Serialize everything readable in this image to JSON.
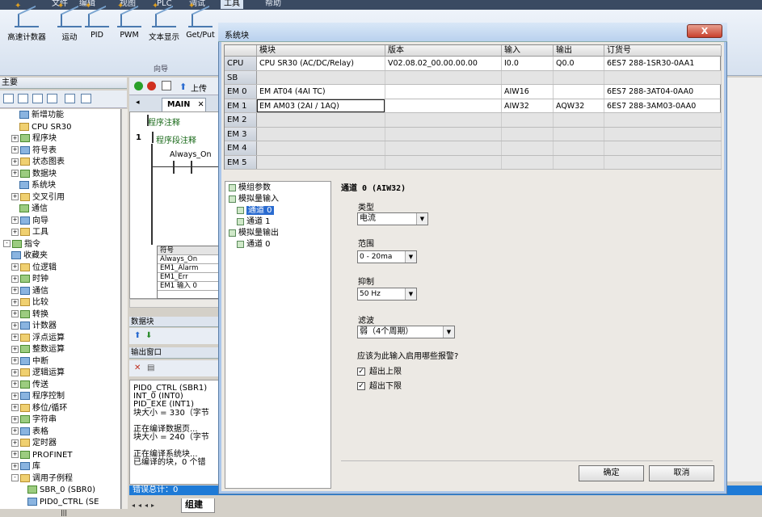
{
  "menubar": {
    "items": [
      "文件",
      "编辑",
      "视图",
      "PLC",
      "调试",
      "工具",
      "帮助"
    ],
    "active": "工具"
  },
  "ribbon": {
    "buttons": [
      "高速计数器",
      "运动",
      "PID",
      "PWM",
      "文本显示",
      "Get/Put"
    ],
    "group": "向导"
  },
  "project_tree": {
    "title": "主要",
    "items": [
      {
        "label": "新增功能",
        "indent": 2,
        "icon": "help-icon"
      },
      {
        "label": "CPU SR30",
        "indent": 2,
        "icon": "cpu-icon"
      },
      {
        "label": "程序块",
        "indent": 1,
        "expand": "+"
      },
      {
        "label": "符号表",
        "indent": 1,
        "expand": "+"
      },
      {
        "label": "状态图表",
        "indent": 1,
        "expand": "+"
      },
      {
        "label": "数据块",
        "indent": 1,
        "expand": "+"
      },
      {
        "label": "系统块",
        "indent": 2
      },
      {
        "label": "交叉引用",
        "indent": 1,
        "expand": "+"
      },
      {
        "label": "通信",
        "indent": 2
      },
      {
        "label": "向导",
        "indent": 1,
        "expand": "+"
      },
      {
        "label": "工具",
        "indent": 1,
        "expand": "+"
      },
      {
        "label": "指令",
        "indent": 0,
        "expand": "-"
      },
      {
        "label": "收藏夹",
        "indent": 1
      },
      {
        "label": "位逻辑",
        "indent": 1,
        "expand": "+"
      },
      {
        "label": "时钟",
        "indent": 1,
        "expand": "+"
      },
      {
        "label": "通信",
        "indent": 1,
        "expand": "+"
      },
      {
        "label": "比较",
        "indent": 1,
        "expand": "+"
      },
      {
        "label": "转换",
        "indent": 1,
        "expand": "+"
      },
      {
        "label": "计数器",
        "indent": 1,
        "expand": "+"
      },
      {
        "label": "浮点运算",
        "indent": 1,
        "expand": "+"
      },
      {
        "label": "整数运算",
        "indent": 1,
        "expand": "+"
      },
      {
        "label": "中断",
        "indent": 1,
        "expand": "+"
      },
      {
        "label": "逻辑运算",
        "indent": 1,
        "expand": "+"
      },
      {
        "label": "传送",
        "indent": 1,
        "expand": "+"
      },
      {
        "label": "程序控制",
        "indent": 1,
        "expand": "+"
      },
      {
        "label": "移位/循环",
        "indent": 1,
        "expand": "+"
      },
      {
        "label": "字符串",
        "indent": 1,
        "expand": "+"
      },
      {
        "label": "表格",
        "indent": 1,
        "expand": "+"
      },
      {
        "label": "定时器",
        "indent": 1,
        "expand": "+"
      },
      {
        "label": "PROFINET",
        "indent": 1,
        "expand": "+"
      },
      {
        "label": "库",
        "indent": 1,
        "expand": "+"
      },
      {
        "label": "调用子例程",
        "indent": 1,
        "expand": "-"
      },
      {
        "label": "SBR_0 (SBR0)",
        "indent": 3
      },
      {
        "label": "PID0_CTRL (SE",
        "indent": 3
      }
    ]
  },
  "editor": {
    "tab": "MAIN",
    "upload": "上传",
    "program_comment": "程序注释",
    "network_number": "1",
    "segment_comment": "程序段注释",
    "contact_label": "Always_On",
    "symbol_table": {
      "header": "符号",
      "rows": [
        "Always_On",
        "EM1_Alarm",
        "EM1_Err",
        "EM1 输入 0"
      ]
    }
  },
  "data_block": {
    "title": "数据块"
  },
  "output": {
    "title": "输出窗口",
    "lines": [
      "PID0_CTRL (SBR1)",
      "INT_0 (INT0)",
      "PID_EXE (INT1)",
      "块大小 = 330（字节",
      "",
      "正在编译数据页...",
      "块大小 = 240（字节",
      "",
      "正在编译系统块...",
      "已编译的块，0 个错"
    ],
    "error_summary": "错误总计：0",
    "build_tab": "组建"
  },
  "dialog": {
    "title": "系统块",
    "close": "X",
    "columns": [
      "模块",
      "版本",
      "输入",
      "输出",
      "订货号"
    ],
    "rows": [
      {
        "slot": "CPU",
        "module": "CPU SR30 (AC/DC/Relay)",
        "version": "V02.08.02_00.00.00.00",
        "input": "I0.0",
        "output": "Q0.0",
        "order": "6ES7 288-1SR30-0AA1"
      },
      {
        "slot": "SB",
        "module": "",
        "version": "",
        "input": "",
        "output": "",
        "order": ""
      },
      {
        "slot": "EM 0",
        "module": "EM AT04 (4AI TC)",
        "version": "",
        "input": "AIW16",
        "output": "",
        "order": "6ES7 288-3AT04-0AA0"
      },
      {
        "slot": "EM 1",
        "module": "EM AM03 (2AI / 1AQ)",
        "version": "",
        "input": "AIW32",
        "output": "AQW32",
        "order": "6ES7 288-3AM03-0AA0"
      },
      {
        "slot": "EM 2",
        "module": "",
        "version": "",
        "input": "",
        "output": "",
        "order": ""
      },
      {
        "slot": "EM 3",
        "module": "",
        "version": "",
        "input": "",
        "output": "",
        "order": ""
      },
      {
        "slot": "EM 4",
        "module": "",
        "version": "",
        "input": "",
        "output": "",
        "order": ""
      },
      {
        "slot": "EM 5",
        "module": "",
        "version": "",
        "input": "",
        "output": "",
        "order": ""
      }
    ],
    "nav": [
      {
        "label": "模组参数"
      },
      {
        "label": "模拟量输入"
      },
      {
        "label": "通道 0",
        "selected": true
      },
      {
        "label": "通道 1"
      },
      {
        "label": "模拟量输出"
      },
      {
        "label": "通道 0"
      }
    ],
    "panel_title": "通道 0 (AIW32)",
    "type_label": "类型",
    "type_value": "电流",
    "range_label": "范围",
    "range_value": "0 - 20ma",
    "suppress_label": "抑制",
    "suppress_value": "50 Hz",
    "filter_label": "滤波",
    "filter_value": "弱（4个周期）",
    "alarm_question": "应该为此输入启用哪些报警?",
    "alarm_upper": "超出上限",
    "alarm_lower": "超出下限",
    "ok": "确定",
    "cancel": "取消"
  }
}
